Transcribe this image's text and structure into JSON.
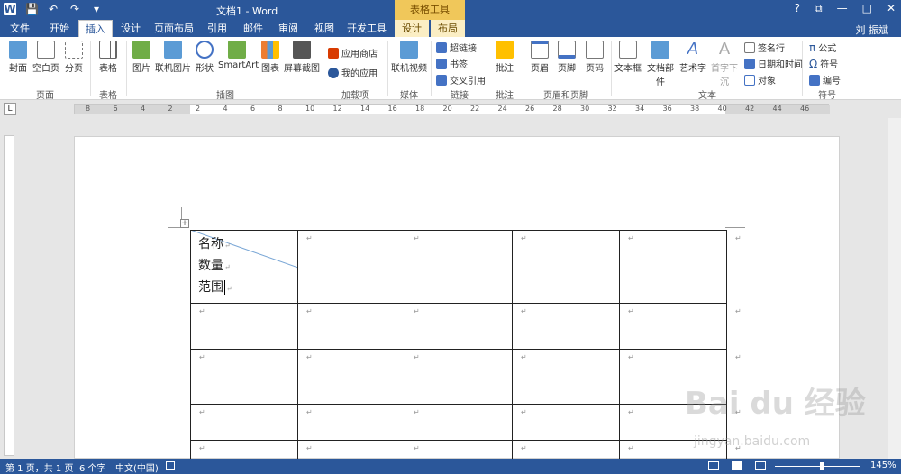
{
  "window": {
    "title": "文档1 - Word",
    "context_tab_header": "表格工具",
    "user": "刘 振斌"
  },
  "qat": {
    "word_logo": "W",
    "save": "💾",
    "undo": "↶",
    "redo": "↷",
    "customize": "▾"
  },
  "window_controls": {
    "help": "?",
    "restore": "⧉",
    "minimize": "—",
    "maximize": "□",
    "close": "✕"
  },
  "tabs": [
    {
      "label": "文件"
    },
    {
      "label": "开始"
    },
    {
      "label": "插入"
    },
    {
      "label": "设计"
    },
    {
      "label": "页面布局"
    },
    {
      "label": "引用"
    },
    {
      "label": "邮件"
    },
    {
      "label": "审阅"
    },
    {
      "label": "视图"
    },
    {
      "label": "开发工具"
    },
    {
      "label": "设计"
    },
    {
      "label": "布局"
    }
  ],
  "ribbon": {
    "pages": {
      "cover": "封面",
      "blank": "空白页",
      "break": "分页",
      "label": "页面"
    },
    "tables": {
      "table": "表格",
      "label": "表格"
    },
    "illustrations": {
      "picture": "图片",
      "online_picture": "联机图片",
      "shapes": "形状",
      "smartart": "SmartArt",
      "chart": "图表",
      "screenshot": "屏幕截图",
      "label": "插图"
    },
    "addins": {
      "store": "应用商店",
      "myapps": "我的应用",
      "label": "加载项"
    },
    "media": {
      "online_video": "联机视频",
      "label": "媒体"
    },
    "links": {
      "hyperlink": "超链接",
      "bookmark": "书签",
      "crossref": "交叉引用",
      "label": "链接"
    },
    "comments": {
      "comment": "批注",
      "label": "批注"
    },
    "headerfooter": {
      "header": "页眉",
      "footer": "页脚",
      "pagenum": "页码",
      "label": "页眉和页脚"
    },
    "text": {
      "textbox": "文本框",
      "quickparts": "文档部件",
      "wordart": "艺术字",
      "dropcap": "首字下沉",
      "signature": "签名行",
      "datetime": "日期和时间",
      "object": "对象",
      "label": "文本"
    },
    "symbols": {
      "equation": "公式",
      "symbol": "符号",
      "numbering": "编号",
      "label": "符号"
    }
  },
  "ruler": {
    "corner": "L",
    "hnums": [
      "8",
      "6",
      "4",
      "2",
      "2",
      "4",
      "6",
      "8",
      "10",
      "12",
      "14",
      "16",
      "18",
      "20",
      "22",
      "24",
      "26",
      "28",
      "30",
      "32",
      "34",
      "36",
      "38",
      "40",
      "42",
      "44",
      "46"
    ]
  },
  "table": {
    "first_cell": [
      "名称",
      "数量",
      "范围"
    ],
    "para_mark": "↵"
  },
  "statusbar": {
    "page": "第 1 页，共 1 页",
    "words": "6 个字",
    "lang": "中文(中国)",
    "zoom": "145%"
  },
  "watermark": {
    "brand": "Bai du 经验",
    "url": "jingyan.baidu.com"
  }
}
